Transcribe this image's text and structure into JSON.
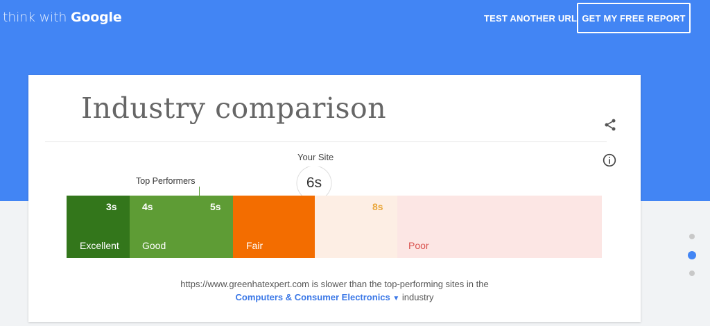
{
  "header": {
    "logo_prefix": "think with",
    "logo_brand": "Google",
    "test_link": "TEST ANOTHER URL",
    "report_button": "GET MY FREE REPORT"
  },
  "card": {
    "title": "Industry comparison",
    "your_site_label": "Your Site",
    "your_site_value": "6s",
    "top_performers_label": "Top Performers",
    "ticks": [
      "3s",
      "4s",
      "5s",
      "8s"
    ],
    "categories": [
      "Excellent",
      "Good",
      "Fair",
      "Poor"
    ],
    "description_line1": "https://www.greenhatexpert.com  is slower than the top-performing sites in the",
    "industry_name": "Computers & Consumer Electronics",
    "industry_suffix": "industry"
  },
  "colors": {
    "brand_blue": "#4285f4",
    "excellent": "#33761b",
    "good": "#5e9c35",
    "fair": "#f36d00",
    "poor_bg": "#fce6e4",
    "link_blue": "#3b78e7"
  },
  "icons": {
    "share": "share-icon",
    "info": "info-icon"
  },
  "pagination": {
    "total": 3,
    "active_index": 1
  }
}
